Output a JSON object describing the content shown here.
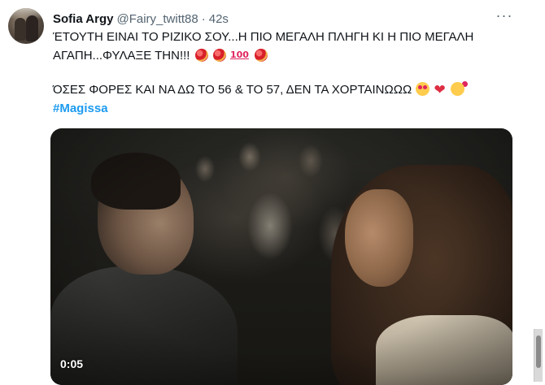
{
  "tweet": {
    "author": {
      "display_name": "Sofia Argy",
      "handle": "@Fairy_twitt88",
      "separator": "·",
      "time": "42s"
    },
    "more_icon": "more-dots-icon",
    "text": {
      "line1": "ΈΤΟΥΤΗ ΕΙΝΑΙ ΤΟ ΡΙΖΙΚΟ ΣΟΥ...Η ΠΙΟ ΜΕΓΑΛΗ ΠΛΗΓΗ ΚΙ Η ΠΙΟ ΜΕΓΑΛΗ",
      "line2": "ΑΓΑΠΗ...ΦΥΛΑΞΕ ΤΗΝ!!!",
      "line3": "ΌΣΕΣ ΦΟΡΕΣ ΚΑΙ ΝΑ ΔΩ ΤΟ 56 & ΤΟ 57, ΔΕΝ ΤΑ ΧΟΡΤΑΙΝΩΩΩ",
      "hashtag": "#Magissa",
      "emoji_100": "100",
      "emoji_heart": "❤"
    },
    "media": {
      "type": "video",
      "timestamp": "0:05"
    },
    "colors": {
      "link": "#1d9bf0",
      "secondary_text": "#536471",
      "primary_text": "#0f1419"
    }
  }
}
